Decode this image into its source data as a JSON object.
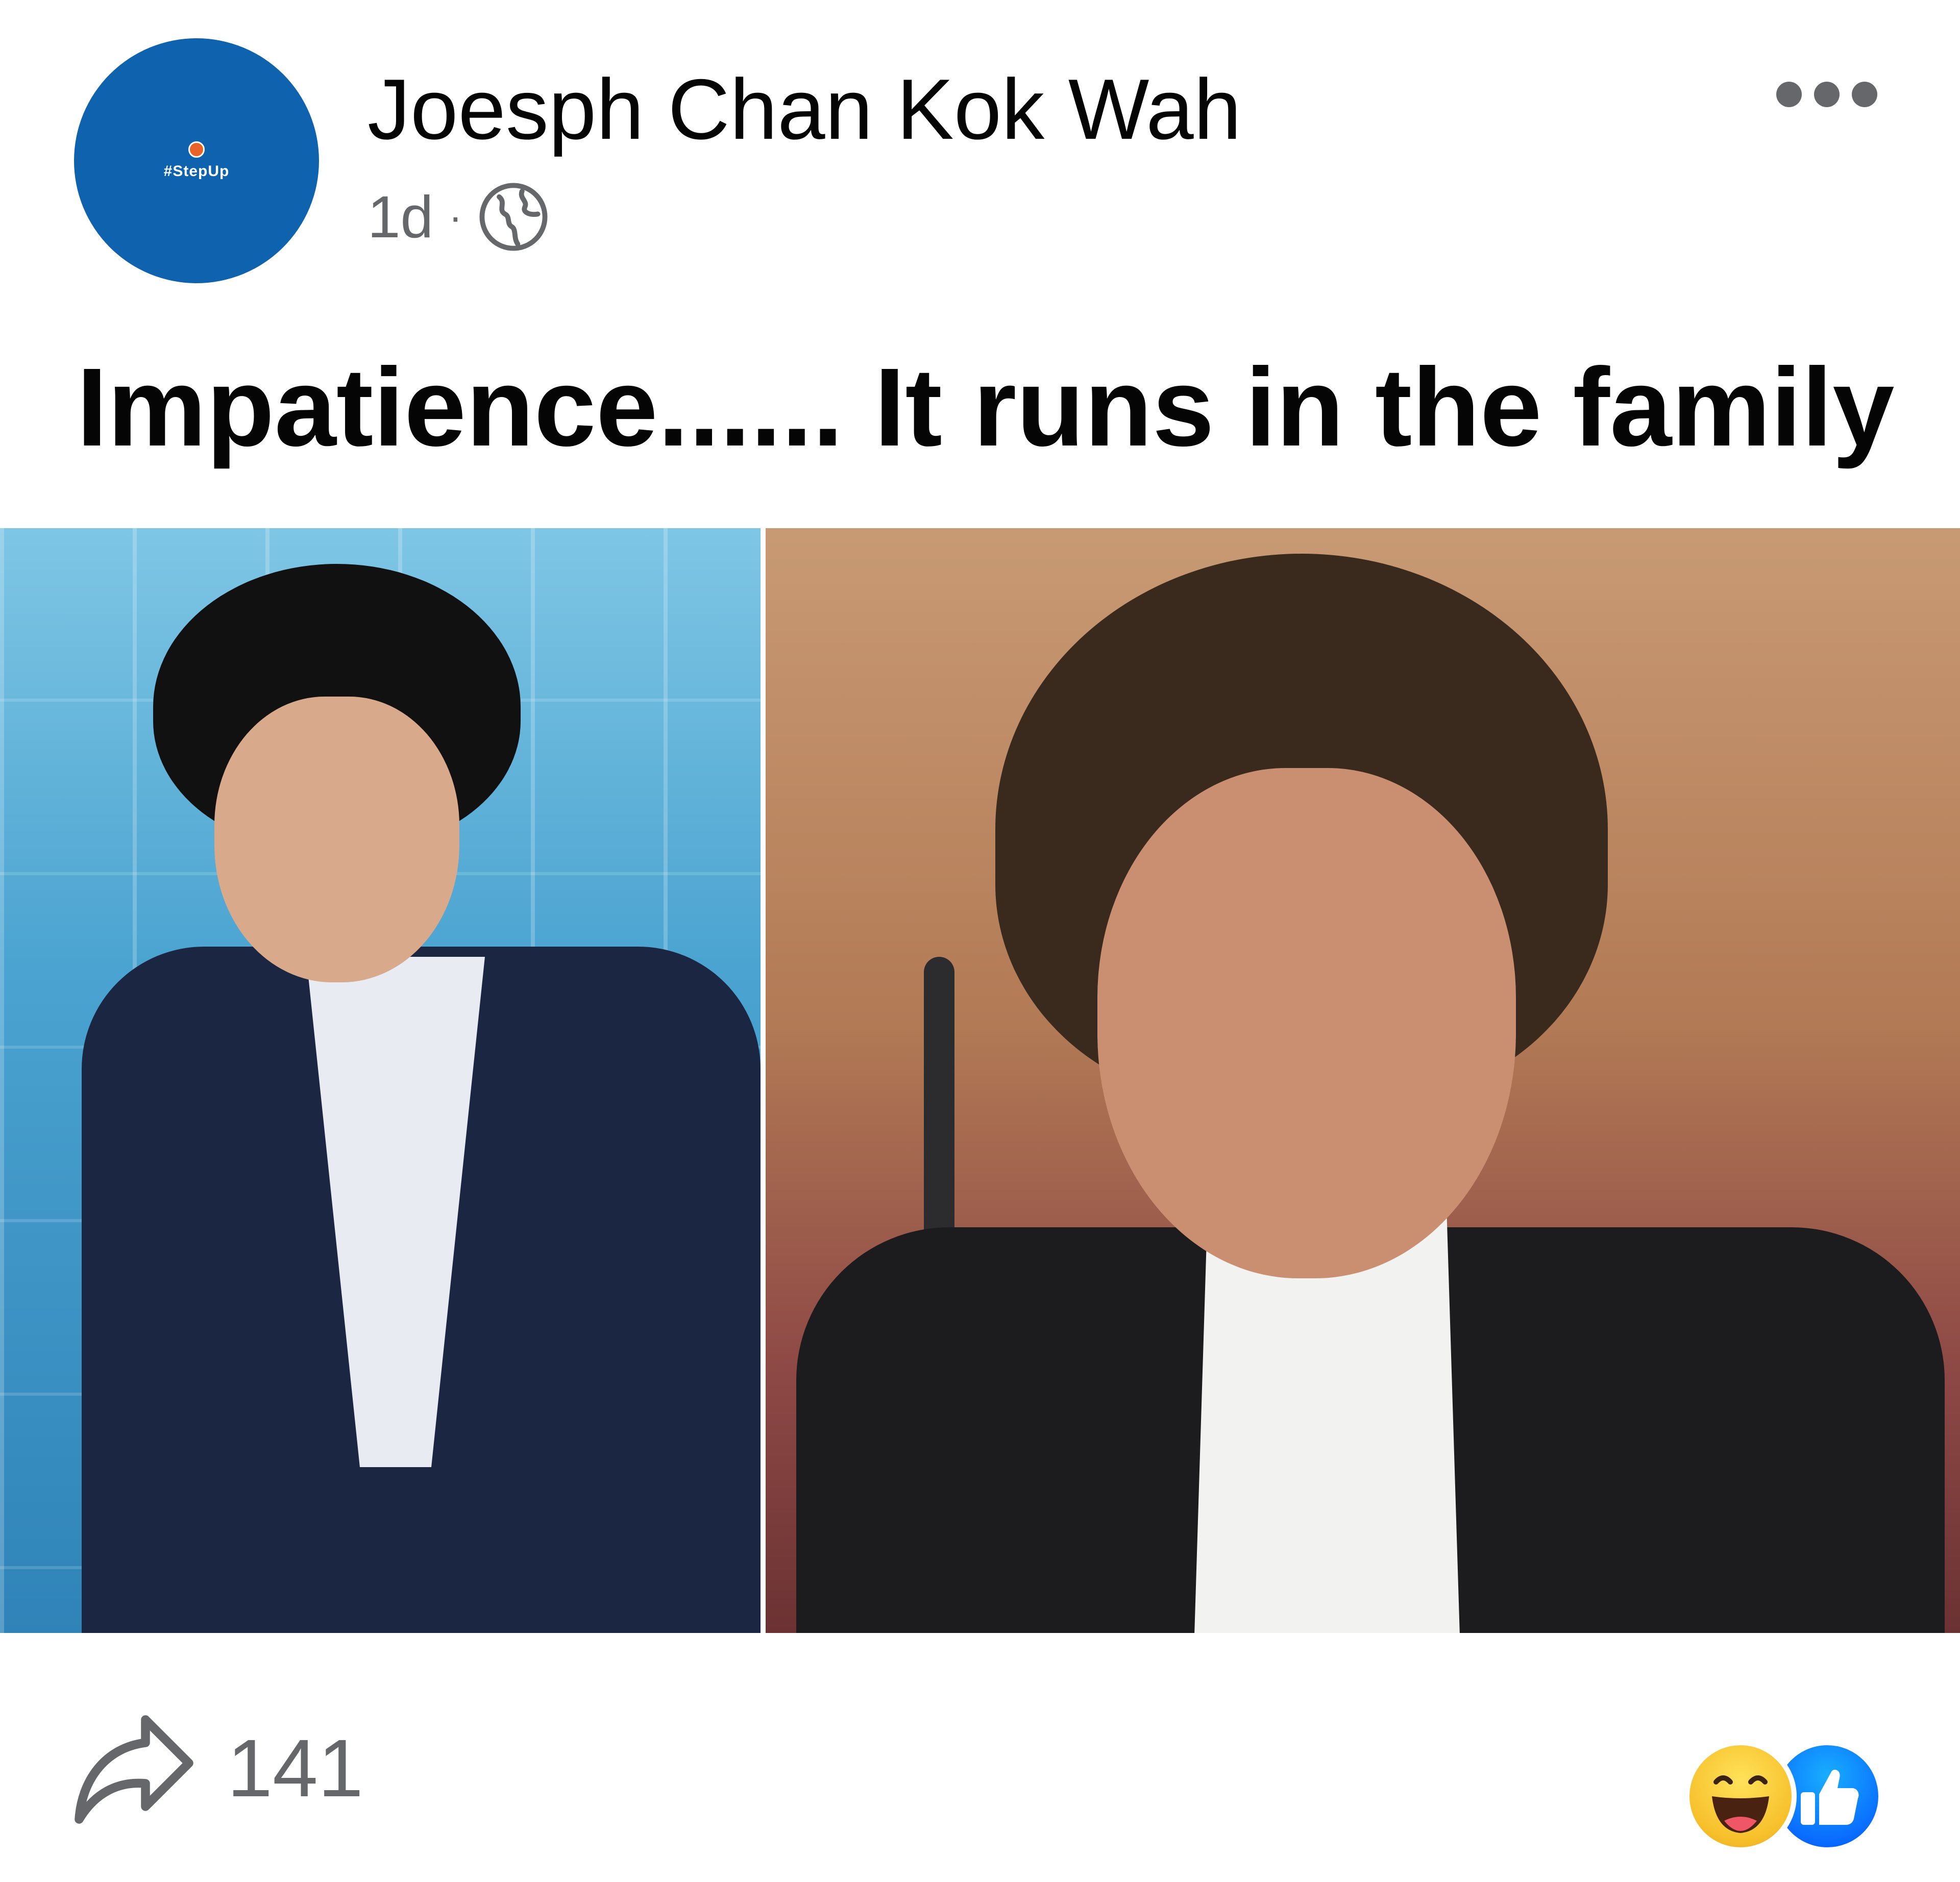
{
  "post": {
    "author": "Joesph Chan Kok Wah",
    "avatar_text": "#StepUp",
    "time": "1d",
    "separator": "·",
    "audience_icon": "globe-icon",
    "caption": "Impatience...... It runs in the family"
  },
  "footer": {
    "share_count": "141",
    "reactions": [
      "haha-icon",
      "like-icon"
    ]
  },
  "colors": {
    "avatar_bg": "#0f62ad",
    "secondary_text": "#65676b",
    "primary_text": "#050505",
    "like_blue": "#0866ff"
  }
}
